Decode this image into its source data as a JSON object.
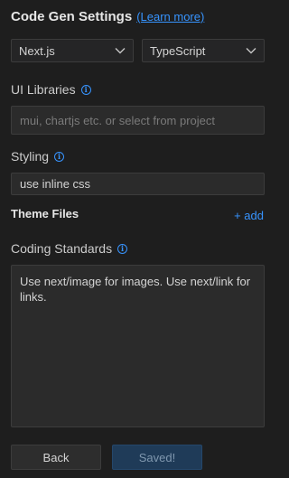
{
  "header": {
    "title": "Code Gen Settings",
    "learn_more": "(Learn more)"
  },
  "selects": {
    "framework": "Next.js",
    "language": "TypeScript"
  },
  "ui_libraries": {
    "label": "UI Libraries",
    "value": "",
    "placeholder": "mui, chartjs etc. or select from project"
  },
  "styling": {
    "label": "Styling",
    "value": "use inline css"
  },
  "theme_files": {
    "label": "Theme Files",
    "add_label": "+ add"
  },
  "coding_standards": {
    "label": "Coding Standards",
    "value": "Use next/image for images. Use next/link for links."
  },
  "footer": {
    "back_label": "Back",
    "saved_label": "Saved!"
  },
  "icons": {
    "info": "info-icon",
    "chevron": "chevron-down-icon"
  },
  "colors": {
    "accent": "#3794ff",
    "background": "#1e1e1e",
    "primary_button": "#1f3b58"
  }
}
